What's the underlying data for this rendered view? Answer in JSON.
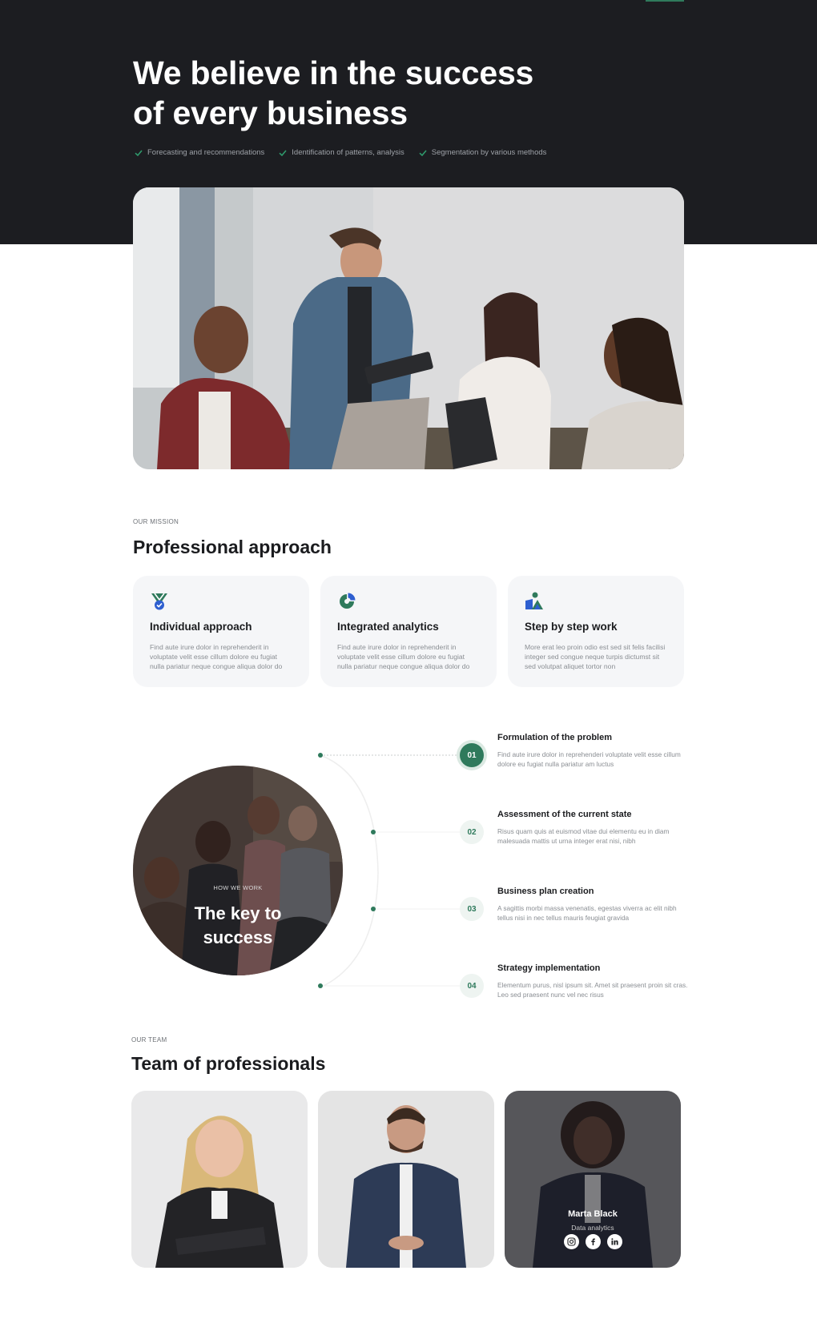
{
  "hero": {
    "title_line1": "We believe in the success",
    "title_line2": "of every business",
    "checks": [
      "Forecasting and recommendations",
      "Identification of patterns, analysis",
      "Segmentation by various methods"
    ],
    "check_color": "#2f9a6c"
  },
  "mission": {
    "eyebrow": "OUR MISSION",
    "title": "Professional approach",
    "cards": [
      {
        "icon": "medal-icon",
        "title": "Individual approach",
        "text": "Find aute irure dolor in reprehenderit in voluptate velit esse cillum dolore eu fugiat nulla pariatur neque congue aliqua dolor do"
      },
      {
        "icon": "pie-chart-icon",
        "title": "Integrated analytics",
        "text": "Find aute irure dolor in reprehenderit in voluptate velit esse cillum dolore eu fugiat nulla pariatur neque congue aliqua dolor do"
      },
      {
        "icon": "shapes-icon",
        "title": "Step by step work",
        "text": "More erat leo proin odio est sed sit felis facilisi integer sed congue neque turpis dictumst sit sed volutpat aliquet tortor non"
      }
    ]
  },
  "process": {
    "eyebrow": "HOW WE WORK",
    "title_line1": "The key to",
    "title_line2": "success",
    "steps": [
      {
        "number": "01",
        "title": "Formulation of the problem",
        "text": "Find aute irure dolor in reprehenderi voluptate velit esse cillum dolore eu fugiat nulla pariatur am luctus"
      },
      {
        "number": "02",
        "title": "Assessment of the current state",
        "text": "Risus quam quis at euismod vitae dui elementu eu in diam malesuada mattis ut urna integer erat nisi, nibh"
      },
      {
        "number": "03",
        "title": "Business plan creation",
        "text": "A sagittis morbi massa venenatis, egestas viverra ac elit nibh tellus nisi in nec tellus mauris feugiat gravida"
      },
      {
        "number": "04",
        "title": "Strategy implementation",
        "text": "Elementum purus, nisl ipsum sit. Amet sit praesent proin sit cras. Leo sed praesent nunc vel nec risus"
      }
    ]
  },
  "team": {
    "eyebrow": "OUR TEAM",
    "title": "Team of professionals",
    "featured": {
      "name": "Marta Black",
      "role": "Data analytics",
      "socials": [
        "instagram-icon",
        "facebook-icon",
        "linkedin-icon"
      ]
    }
  },
  "colors": {
    "accent": "#2f7a5c",
    "dark": "#1c1d21",
    "card_bg": "#f5f6f8"
  }
}
